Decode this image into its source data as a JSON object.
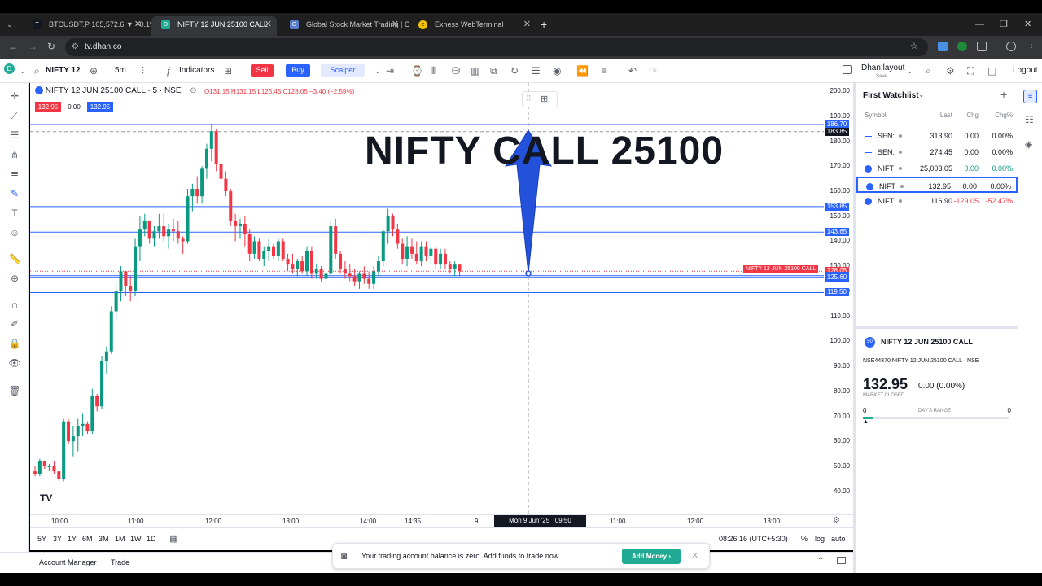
{
  "browser": {
    "tabs": [
      {
        "title": "BTCUSDT.P 105,572.6 ▼ −0.1%",
        "active": false
      },
      {
        "title": "NIFTY 12 JUN 25100 CALL",
        "active": true
      },
      {
        "title": "Global Stock Market Trading | C",
        "active": false
      },
      {
        "title": "Exness WebTerminal",
        "active": false
      }
    ],
    "url": "tv.dhan.co"
  },
  "toolbar": {
    "symbol": "NIFTY 12",
    "interval": "5m",
    "indicators": "Indicators",
    "sell": "Sell",
    "buy": "Buy",
    "scalper": "Scalper",
    "layout_name": "Dhan layout",
    "layout_sub": "Save",
    "logout": "Logout"
  },
  "legend": {
    "title": "NIFTY 12 JUN 25100 CALL · 5 · NSE",
    "ohlc": "O131.15 H131.15 L125.45 C128.05 −3.40 (−2.59%)",
    "bid": "132.95",
    "spread": "0.00",
    "ask": "132.95"
  },
  "annotation": "NIFTY CALL 25100",
  "chart_data": {
    "type": "candlestick",
    "series_label": "NIFTY 12 JUN 25100 CALL",
    "ylim": [
      36,
      202
    ],
    "y_ticks": [
      200,
      190,
      180,
      170,
      160,
      150,
      140,
      130,
      120,
      110,
      100,
      90,
      80,
      70,
      60,
      50,
      40
    ],
    "x_ticks": [
      "10:00",
      "11:00",
      "12:00",
      "13:00",
      "14:00",
      "14:35",
      "9",
      "11:00",
      "12:00",
      "13:00"
    ],
    "crosshair_time": "Mon 9 Jun '25   09:50",
    "crosshair_price": "183.85",
    "horizontal_lines": [
      186.7,
      153.85,
      143.65,
      126.25,
      125.6,
      119.5
    ],
    "last_price": 128.05,
    "candles": [
      [
        48,
        50,
        46,
        47
      ],
      [
        47,
        53,
        46,
        52
      ],
      [
        52,
        52,
        49,
        50
      ],
      [
        50,
        51,
        48,
        50
      ],
      [
        50,
        52,
        47,
        48
      ],
      [
        48,
        47,
        44,
        45
      ],
      [
        45,
        69,
        44,
        68
      ],
      [
        68,
        69,
        59,
        60
      ],
      [
        60,
        66,
        54,
        62
      ],
      [
        62,
        69,
        56,
        66
      ],
      [
        66,
        71,
        62,
        67
      ],
      [
        67,
        68,
        63,
        64
      ],
      [
        64,
        81,
        63,
        78
      ],
      [
        78,
        79,
        72,
        74
      ],
      [
        74,
        94,
        73,
        92
      ],
      [
        92,
        98,
        87,
        96
      ],
      [
        96,
        114,
        95,
        112
      ],
      [
        112,
        124,
        109,
        120
      ],
      [
        120,
        130,
        116,
        128
      ],
      [
        128,
        127,
        118,
        122
      ],
      [
        122,
        126,
        116,
        120
      ],
      [
        120,
        141,
        118,
        138
      ],
      [
        138,
        150,
        132,
        145
      ],
      [
        145,
        151,
        142,
        148
      ],
      [
        148,
        147,
        139,
        141
      ],
      [
        141,
        146,
        138,
        144
      ],
      [
        144,
        151,
        141,
        146
      ],
      [
        146,
        151,
        140,
        142
      ],
      [
        142,
        147,
        137,
        145
      ],
      [
        145,
        149,
        140,
        144
      ],
      [
        144,
        148,
        139,
        141
      ],
      [
        141,
        142,
        135,
        140
      ],
      [
        140,
        161,
        139,
        158
      ],
      [
        158,
        163,
        152,
        161
      ],
      [
        161,
        166,
        155,
        158
      ],
      [
        158,
        170,
        155,
        169
      ],
      [
        169,
        179,
        165,
        177
      ],
      [
        177,
        187,
        172,
        184
      ],
      [
        184,
        185,
        168,
        171
      ],
      [
        171,
        175,
        163,
        165
      ],
      [
        165,
        168,
        158,
        160
      ],
      [
        160,
        161,
        146,
        148
      ],
      [
        148,
        151,
        140,
        146
      ],
      [
        146,
        149,
        141,
        147
      ],
      [
        147,
        150,
        138,
        143
      ],
      [
        143,
        145,
        132,
        135
      ],
      [
        135,
        142,
        133,
        140
      ],
      [
        140,
        141,
        132,
        133
      ],
      [
        133,
        138,
        130,
        136
      ],
      [
        136,
        141,
        132,
        138
      ],
      [
        138,
        139,
        133,
        134
      ],
      [
        134,
        141,
        132,
        140
      ],
      [
        140,
        141,
        132,
        133
      ],
      [
        133,
        135,
        128,
        131
      ],
      [
        131,
        135,
        127,
        129
      ],
      [
        129,
        133,
        126,
        132
      ],
      [
        132,
        134,
        127,
        128
      ],
      [
        128,
        138,
        126,
        136
      ],
      [
        136,
        138,
        125,
        127
      ],
      [
        127,
        131,
        125,
        129
      ],
      [
        129,
        130,
        124,
        125
      ],
      [
        125,
        128,
        121,
        127
      ],
      [
        127,
        148,
        126,
        146
      ],
      [
        146,
        149,
        133,
        135
      ],
      [
        135,
        136,
        127,
        129
      ],
      [
        129,
        132,
        125,
        127
      ],
      [
        127,
        131,
        124,
        126
      ],
      [
        126,
        129,
        122,
        124
      ],
      [
        124,
        128,
        121,
        127
      ],
      [
        127,
        130,
        123,
        125
      ],
      [
        125,
        128,
        121,
        123
      ],
      [
        123,
        130,
        121,
        128
      ],
      [
        128,
        134,
        126,
        132
      ],
      [
        132,
        145,
        130,
        144
      ],
      [
        144,
        153,
        139,
        150
      ],
      [
        150,
        151,
        142,
        145
      ],
      [
        145,
        147,
        137,
        139
      ],
      [
        139,
        141,
        131,
        133
      ],
      [
        133,
        142,
        130,
        138
      ],
      [
        138,
        141,
        133,
        135
      ],
      [
        135,
        140,
        131,
        132
      ],
      [
        132,
        140,
        130,
        138
      ],
      [
        138,
        140,
        132,
        134
      ],
      [
        134,
        139,
        131,
        137
      ],
      [
        137,
        138,
        129,
        131
      ],
      [
        131,
        137,
        129,
        135
      ],
      [
        135,
        137,
        129,
        131
      ],
      [
        131,
        132,
        127,
        129
      ],
      [
        129,
        132,
        126,
        131
      ],
      [
        131,
        131,
        126,
        128
      ]
    ]
  },
  "price_axis_tags": [
    {
      "price": "186.70",
      "bg": "#2962ff"
    },
    {
      "price": "183.85",
      "bg": "#131722"
    },
    {
      "price": "153.85",
      "bg": "#2962ff"
    },
    {
      "price": "143.65",
      "bg": "#2962ff"
    },
    {
      "price": "128.05",
      "bg": "#f23645"
    },
    {
      "price": "126.25",
      "bg": "#2962ff"
    },
    {
      "price": "125.60",
      "bg": "#2962ff"
    },
    {
      "price": "119.50",
      "bg": "#2962ff"
    }
  ],
  "last_price_label": "NIFTY 12 JUN 25100 CALL",
  "timeframes": [
    "5Y",
    "3Y",
    "1Y",
    "6M",
    "3M",
    "1M",
    "1W",
    "1D"
  ],
  "clock": "08:26:16 (UTC+5:30)",
  "scale_opts": [
    "%",
    "log",
    "auto"
  ],
  "account": {
    "manager": "Account Manager",
    "trade": "Trade"
  },
  "notification": {
    "text": "Your trading account balance is zero. Add funds to trade now.",
    "button": "Add Money"
  },
  "watchlist": {
    "title": "First Watchlist",
    "headers": [
      "Symbol",
      "Last",
      "Chg",
      "Chg%"
    ],
    "rows": [
      {
        "sym": "SEN:",
        "last": "313.90",
        "chg": "0.00",
        "pct": "0.00%",
        "color": "#131722"
      },
      {
        "sym": "SEN:",
        "last": "274.45",
        "chg": "0.00",
        "pct": "0.00%",
        "color": "#131722"
      },
      {
        "sym": "NIFT",
        "last": "25,003.05",
        "chg": "0.00",
        "pct": "0.00%",
        "color": "#089981"
      },
      {
        "sym": "NIFT",
        "last": "132.95",
        "chg": "0.00",
        "pct": "0.00%",
        "color": "#131722"
      },
      {
        "sym": "NIFT",
        "last": "116.90",
        "chg": "-129.05",
        "pct": "-52.47%",
        "color": "#f23645"
      }
    ]
  },
  "details": {
    "name": "NIFTY 12 JUN 25100 CALL",
    "code": "NSE44870:NIFTY 12 JUN 25100 CALL · NSE",
    "price": "132.95",
    "change": "0.00 (0.00%)",
    "status": "MARKET CLOSED",
    "range_low": "0",
    "range_label": "DAY'S RANGE",
    "range_high": "0"
  }
}
